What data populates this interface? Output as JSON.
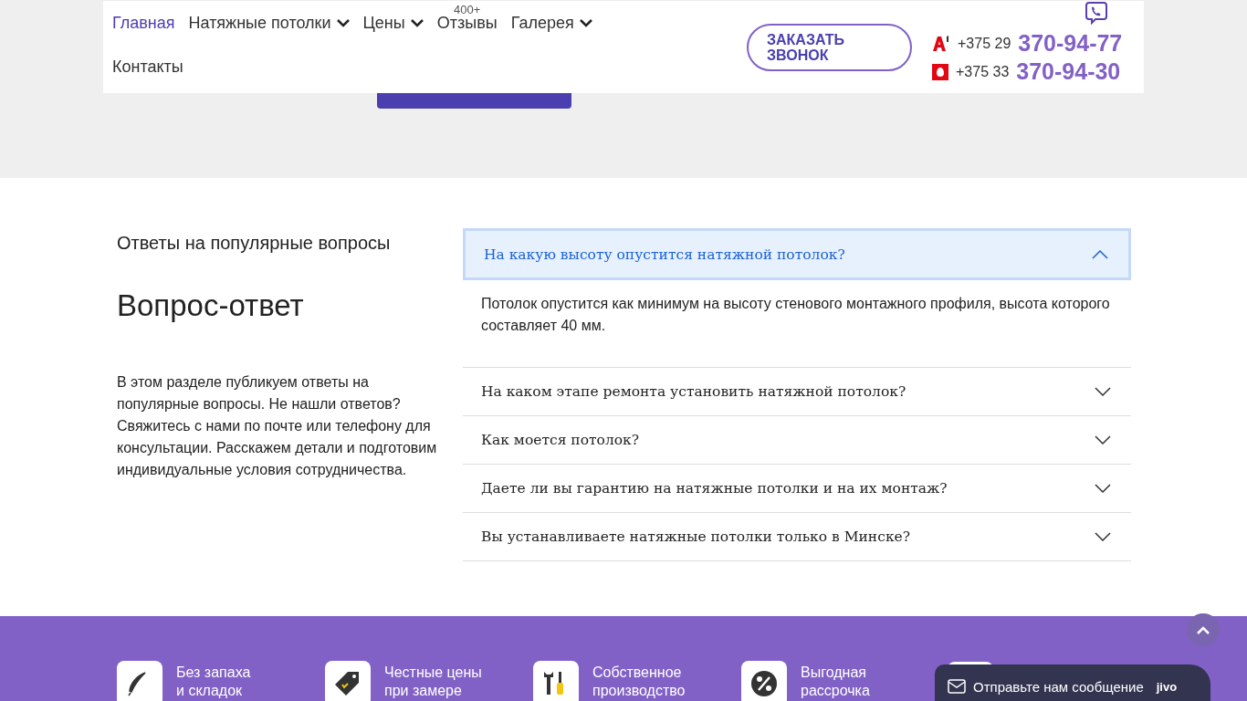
{
  "nav": {
    "items": [
      {
        "label": "Главная",
        "selected": true,
        "dropdown": false
      },
      {
        "label": "Натяжные потолки",
        "selected": false,
        "dropdown": true
      },
      {
        "label": "Цены",
        "selected": false,
        "dropdown": true
      },
      {
        "label": "Отзывы",
        "selected": false,
        "dropdown": false,
        "badge": "400+"
      },
      {
        "label": "Галерея",
        "selected": false,
        "dropdown": true
      },
      {
        "label": "Контакты",
        "selected": false,
        "dropdown": false
      }
    ],
    "callback_button": "ЗАКАЗАТЬ ЗВОНОК",
    "phones": [
      {
        "kind": "a1",
        "prefix": "+375 29",
        "number": "370-94-77"
      },
      {
        "kind": "mts",
        "prefix": "+375 33",
        "number": "370-94-30"
      }
    ]
  },
  "faq": {
    "subtitle": "Ответы на популярные вопросы",
    "title": "Вопрос-ответ",
    "description": "В этом разделе публикуем ответы на популярные вопросы. Не нашли ответов? Свяжитесь с нами по почте или телефону для консультации. Расскажем детали и подготовим индивидуальные условия сотрудничества.",
    "items": [
      {
        "question": "На какую высоту опустится натяжной потолок?",
        "expanded": true,
        "answer": "Потолок опустится как минимум на высоту стенового монтажного профиля, высота которого составляет 40 мм."
      },
      {
        "question": "На каком этапе ремонта установить натяжной потолок?",
        "expanded": false
      },
      {
        "question": "Как моется потолок?",
        "expanded": false
      },
      {
        "question": "Даете ли вы гарантию на натяжные потолки и на их монтаж?",
        "expanded": false
      },
      {
        "question": "Вы устанавливаете натяжные потолки только в Минске?",
        "expanded": false
      }
    ]
  },
  "features": [
    {
      "kind": "feather",
      "lines": [
        "Без запаха",
        "и складок"
      ]
    },
    {
      "kind": "tag",
      "lines": [
        "Честные цены",
        "при замере"
      ]
    },
    {
      "kind": "tools",
      "lines": [
        "Собственное",
        "производство"
      ]
    },
    {
      "kind": "percent",
      "lines": [
        "Выгодная",
        "рассрочка"
      ]
    }
  ],
  "chat": {
    "label": "Отправьте нам сообщение",
    "brand": "jivo"
  }
}
